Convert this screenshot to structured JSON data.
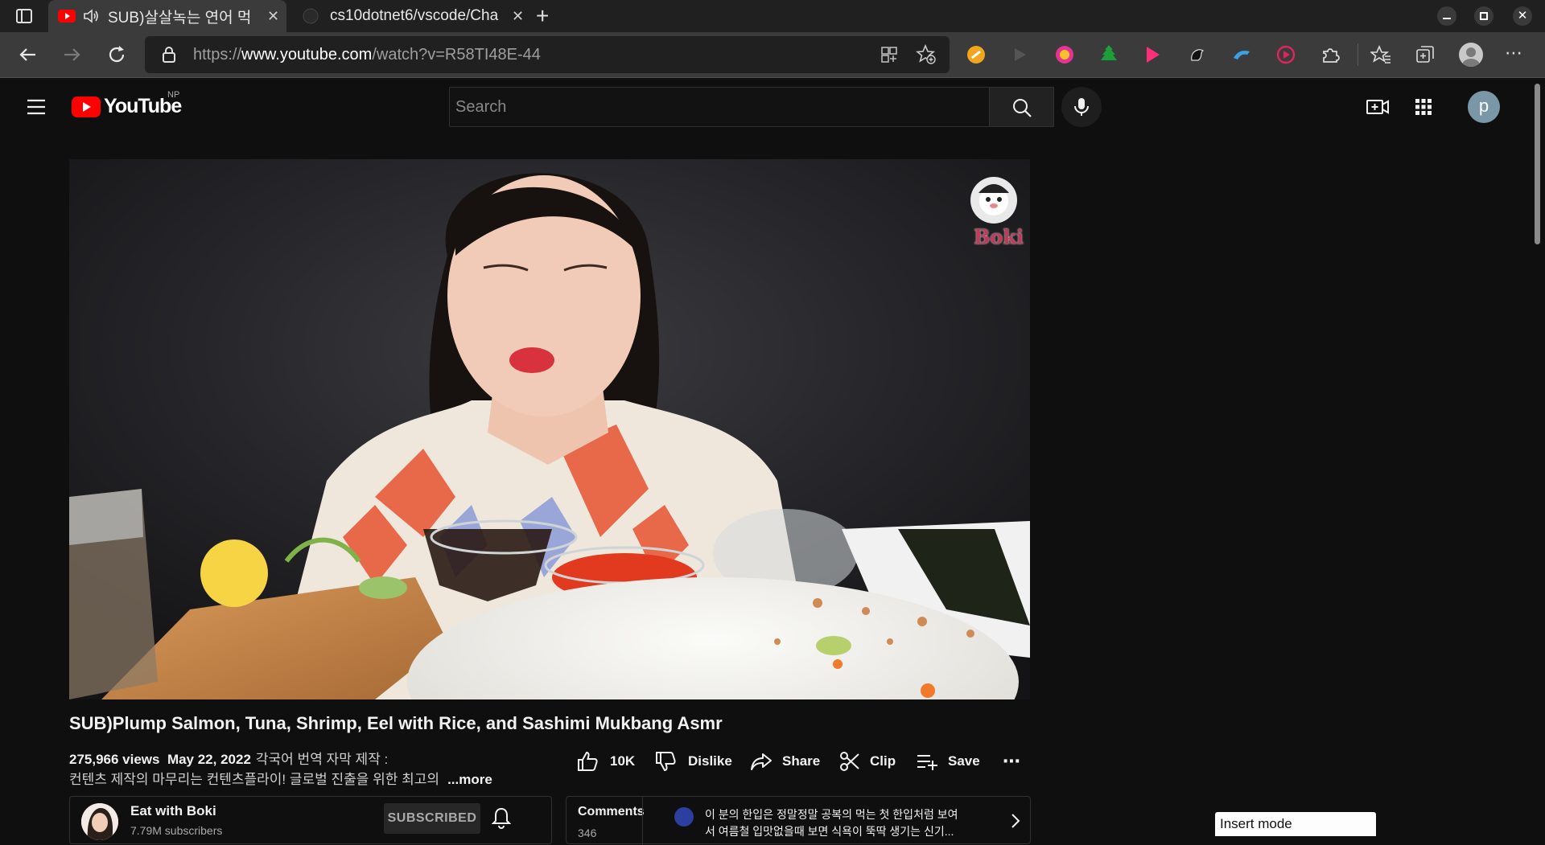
{
  "browser": {
    "tabs": [
      {
        "title": "SUB)살살녹는 연어 먹",
        "active": true
      },
      {
        "title": "cs10dotnet6/vscode/Cha",
        "active": false
      }
    ],
    "new_tab_symbol": "+",
    "address": {
      "prefix": "https://",
      "host": "www.youtube.com",
      "path": "/watch?v=R58TI48E-44"
    },
    "icons": [
      "sidebar-icon",
      "back-icon",
      "forward-icon",
      "refresh-icon",
      "lock-icon",
      "app-available-icon",
      "add-favorite-icon",
      "favorites-icon",
      "collections-icon",
      "profile-icon",
      "more-icon"
    ],
    "extensions": [
      "extension-orange-icon",
      "extension-play-icon",
      "extension-pink-icon",
      "extension-green-icon",
      "extension-pink-play-icon",
      "extension-dark-icon",
      "extension-blue-icon",
      "extension-red-icon",
      "extensions-puzzle-icon"
    ]
  },
  "youtube": {
    "logo_text": "YouTube",
    "country_code": "NP",
    "search_placeholder": "Search",
    "avatar_letter": "p",
    "accent": "#ff0000"
  },
  "video": {
    "watermark": "Boki",
    "title": "SUB)Plump Salmon, Tuna, Shrimp, Eel with Rice, and Sashimi Mukbang Asmr",
    "views": "275,966 views",
    "date": "May 22, 2022",
    "desc_line1": "각국어 번역 자막 제작 :",
    "desc_line2": "컨텐츠 제작의 마무리는 컨텐츠플라이! 글로벌 진출을 위한 최고의",
    "more": "...more"
  },
  "actions": {
    "like_count": "10K",
    "dislike": "Dislike",
    "share": "Share",
    "clip": "Clip",
    "save": "Save"
  },
  "channel": {
    "name": "Eat with Boki",
    "subscribers": "7.79M subscribers",
    "subscribe_state": "SUBSCRIBED"
  },
  "comments": {
    "label": "Comments",
    "count": "346",
    "preview_line1": "이 분의 한입은 정말정말 공복의 먹는 첫 한입처럼 보여",
    "preview_line2": "서 여름철 입맛없을때 보면 식욕이 뚝딱 생기는 신기..."
  },
  "status": {
    "mode": "Insert mode"
  }
}
